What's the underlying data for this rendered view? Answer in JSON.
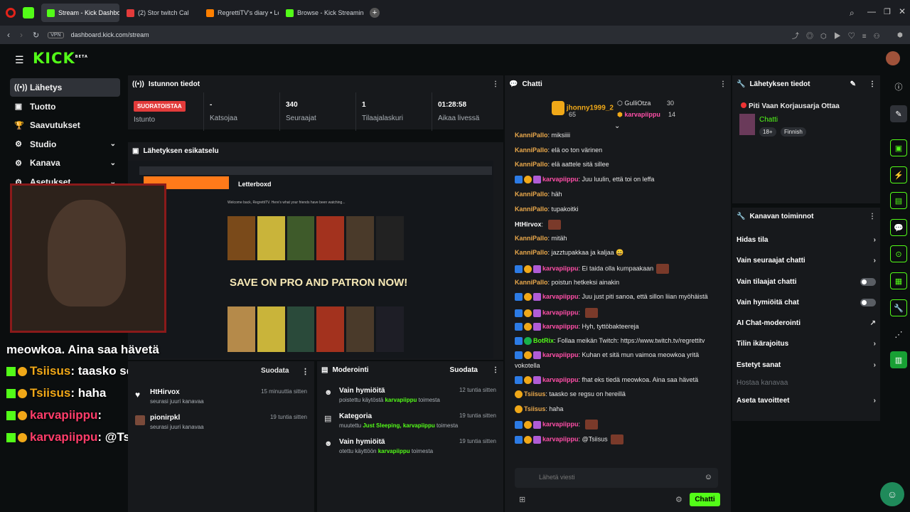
{
  "tabs": [
    {
      "label": "Stream - Kick Dashboard",
      "color": "#53fc18"
    },
    {
      "label": "(2) Stor twitch Cal",
      "color": "#e33b3b"
    },
    {
      "label": "RegrettiTV's diary • Letterb",
      "color": "#ff8000"
    },
    {
      "label": "Browse - Kick Streaming",
      "color": "#53fc18"
    }
  ],
  "url": {
    "vpn": "VPN",
    "address": "dashboard.kick.com/stream"
  },
  "brand": {
    "logo": "KICK",
    "beta": "BETA",
    "accent": "#53fc18"
  },
  "nav": [
    {
      "label": "Lähetys",
      "icon": "broadcast-icon"
    },
    {
      "label": "Tuotto",
      "icon": "money-icon"
    },
    {
      "label": "Saavutukset",
      "icon": "trophy-icon"
    },
    {
      "label": "Studio",
      "icon": "studio-icon"
    },
    {
      "label": "Kanava",
      "icon": "channel-icon"
    },
    {
      "label": "Asetukset",
      "icon": "settings-icon"
    }
  ],
  "session": {
    "title": "Istunnon tiedot",
    "live_badge": "SUORATOISTAA",
    "stats": [
      {
        "value": "",
        "label": "Istunto"
      },
      {
        "value": "-",
        "label": "Katsojaa"
      },
      {
        "value": "340",
        "label": "Seuraajat"
      },
      {
        "value": "1",
        "label": "Tilaajalaskuri"
      },
      {
        "value": "01:28:58",
        "label": "Aikaa livessä"
      }
    ]
  },
  "preview": {
    "title": "Lähetyksen esikatselu",
    "site": "Letterboxd",
    "welcome": "Welcome back, RegrettiTV. Here's what your friends have been watching...",
    "promo": "SAVE ON PRO AND PATRON NOW!"
  },
  "activity": {
    "filter": "Suodata"
  },
  "moderation": {
    "title": "Moderointi",
    "filter": "Suodata",
    "items": [
      {
        "title": "Vain hymiöitä",
        "pre": "poistettu käytöstä ",
        "who": "karvapiippu",
        "post": " toimesta",
        "time": "12 tuntia sitten"
      },
      {
        "title": "Kategoria",
        "pre": "muutettu ",
        "who": "Just Sleeping, karvapiippu",
        "post": " toimesta",
        "time": "19 tuntia sitten"
      },
      {
        "title": "Vain hymiöitä",
        "pre": "otettu käyttöön ",
        "who": "karvapiippu",
        "post": " toimesta",
        "time": "19 tuntia sitten"
      }
    ]
  },
  "follows": [
    {
      "name": "HtHirvox",
      "sub": "seurasi juuri kanavaa",
      "time": "15 minuuttia sitten"
    },
    {
      "name": "pionirpkl",
      "sub": "seurasi juuri kanavaa",
      "time": "19 tuntia sitten"
    }
  ],
  "chat": {
    "title": "Chatti",
    "top_gifters": [
      {
        "name": "jhonny1999_2",
        "count": "65"
      },
      {
        "name": "GulliOtza",
        "count": "30"
      },
      {
        "name": "karvapiippu",
        "count": "14"
      }
    ],
    "messages": [
      {
        "user": "KanniPallo",
        "cls": "u-orange",
        "badges": [],
        "text": "miksiiii"
      },
      {
        "user": "KanniPallo",
        "cls": "u-orange",
        "badges": [],
        "text": "elä oo ton värinen"
      },
      {
        "user": "KanniPallo",
        "cls": "u-orange",
        "badges": [],
        "text": "elä aattele sitä sillee"
      },
      {
        "user": "karvapiippu",
        "cls": "u-pink",
        "badges": [
          "b-blue",
          "b-gold",
          "b-purple"
        ],
        "text": "Juu luulin, että toi on leffa"
      },
      {
        "user": "KanniPallo",
        "cls": "u-orange",
        "badges": [],
        "text": "häh"
      },
      {
        "user": "KanniPallo",
        "cls": "u-orange",
        "badges": [],
        "text": "tupakoitki"
      },
      {
        "user": "HtHirvox",
        "cls": "u-white",
        "badges": [],
        "text": ""
      },
      {
        "user": "KanniPallo",
        "cls": "u-orange",
        "badges": [],
        "text": "mitäh"
      },
      {
        "user": "KanniPallo",
        "cls": "u-orange",
        "badges": [],
        "text": "jazztupakkaa ja kaljaa 😄"
      },
      {
        "user": "karvapiippu",
        "cls": "u-pink",
        "badges": [
          "b-blue",
          "b-gold",
          "b-purple"
        ],
        "text": "Ei taida olla kumpaakaan"
      },
      {
        "user": "KanniPallo",
        "cls": "u-orange",
        "badges": [],
        "text": "poistun hetkeksi ainakin"
      },
      {
        "user": "karvapiippu",
        "cls": "u-pink",
        "badges": [
          "b-blue",
          "b-gold",
          "b-purple"
        ],
        "text": "Juu just piti sanoa, että sillon liian myöhäistä"
      },
      {
        "user": "karvapiippu",
        "cls": "u-pink",
        "badges": [
          "b-blue",
          "b-gold",
          "b-purple"
        ],
        "text": ""
      },
      {
        "user": "karvapiippu",
        "cls": "u-pink",
        "badges": [
          "b-blue",
          "b-gold",
          "b-purple"
        ],
        "text": "Hyh, tyttöbakteereja"
      },
      {
        "user": "BotRix",
        "cls": "u-green",
        "badges": [
          "b-blue",
          "b-green"
        ],
        "text": "Follaa meikän Twitch: https://www.twitch.tv/regrettitv"
      },
      {
        "user": "karvapiippu",
        "cls": "u-pink",
        "badges": [
          "b-blue",
          "b-gold",
          "b-purple"
        ],
        "text": "Kuhan et sitä mun vaimoa meowkoa yritä"
      },
      {
        "user": "",
        "cls": "",
        "badges": [],
        "text": "vokotella"
      },
      {
        "user": "karvapiippu",
        "cls": "u-pink",
        "badges": [
          "b-blue",
          "b-gold",
          "b-purple"
        ],
        "text": "fhat eks tiedä meowkoa. Aina saa hävetä"
      },
      {
        "user": "Tsiisus",
        "cls": "u-orange",
        "badges": [
          "b-gold"
        ],
        "text": "taasko se regsu on hereillä"
      },
      {
        "user": "Tsiisus",
        "cls": "u-orange",
        "badges": [
          "b-gold"
        ],
        "text": "haha"
      },
      {
        "user": "karvapiippu",
        "cls": "u-pink",
        "badges": [
          "b-blue",
          "b-gold",
          "b-purple"
        ],
        "text": ""
      },
      {
        "user": "karvapiippu",
        "cls": "u-pink",
        "badges": [
          "b-blue",
          "b-gold",
          "b-purple"
        ],
        "text": "@Tsiisus"
      }
    ],
    "input_placeholder": "Lähetä viesti",
    "send_label": "Chatti"
  },
  "stream_info": {
    "title": "Lähetyksen tiedot",
    "stream_title": "Piti Vaan Korjausarja Ottaa",
    "category": "Chatti",
    "tags": [
      "18+",
      "Finnish"
    ]
  },
  "channel_actions": {
    "title": "Kanavan toiminnot",
    "items": [
      {
        "label": "Hidas tila",
        "control": "arrow"
      },
      {
        "label": "Vain seuraajat chatti",
        "control": "arrow"
      },
      {
        "label": "Vain tilaajat chatti",
        "control": "toggle"
      },
      {
        "label": "Vain hymiöitä chat",
        "control": "toggle"
      },
      {
        "label": "AI Chat-moderointi",
        "control": "external"
      },
      {
        "label": "Tilin ikärajoitus",
        "control": "arrow"
      },
      {
        "label": "Estetyt sanat",
        "control": "arrow"
      },
      {
        "label": "Hostaa kanavaa",
        "control": "disabled"
      },
      {
        "label": "Aseta tavoitteet",
        "control": "arrow"
      }
    ]
  },
  "overlay": {
    "lines": [
      {
        "user": "",
        "text": "meowkoa. Aina saa hävetä"
      },
      {
        "user": "Tsiisus",
        "text": ": taasko se regsu on hereillä"
      },
      {
        "user": "Tsiisus",
        "text": ": haha"
      },
      {
        "user": "karvapiippu",
        "text": ":"
      },
      {
        "user": "karvapiippu",
        "text": ": @Tsiisus"
      }
    ]
  }
}
